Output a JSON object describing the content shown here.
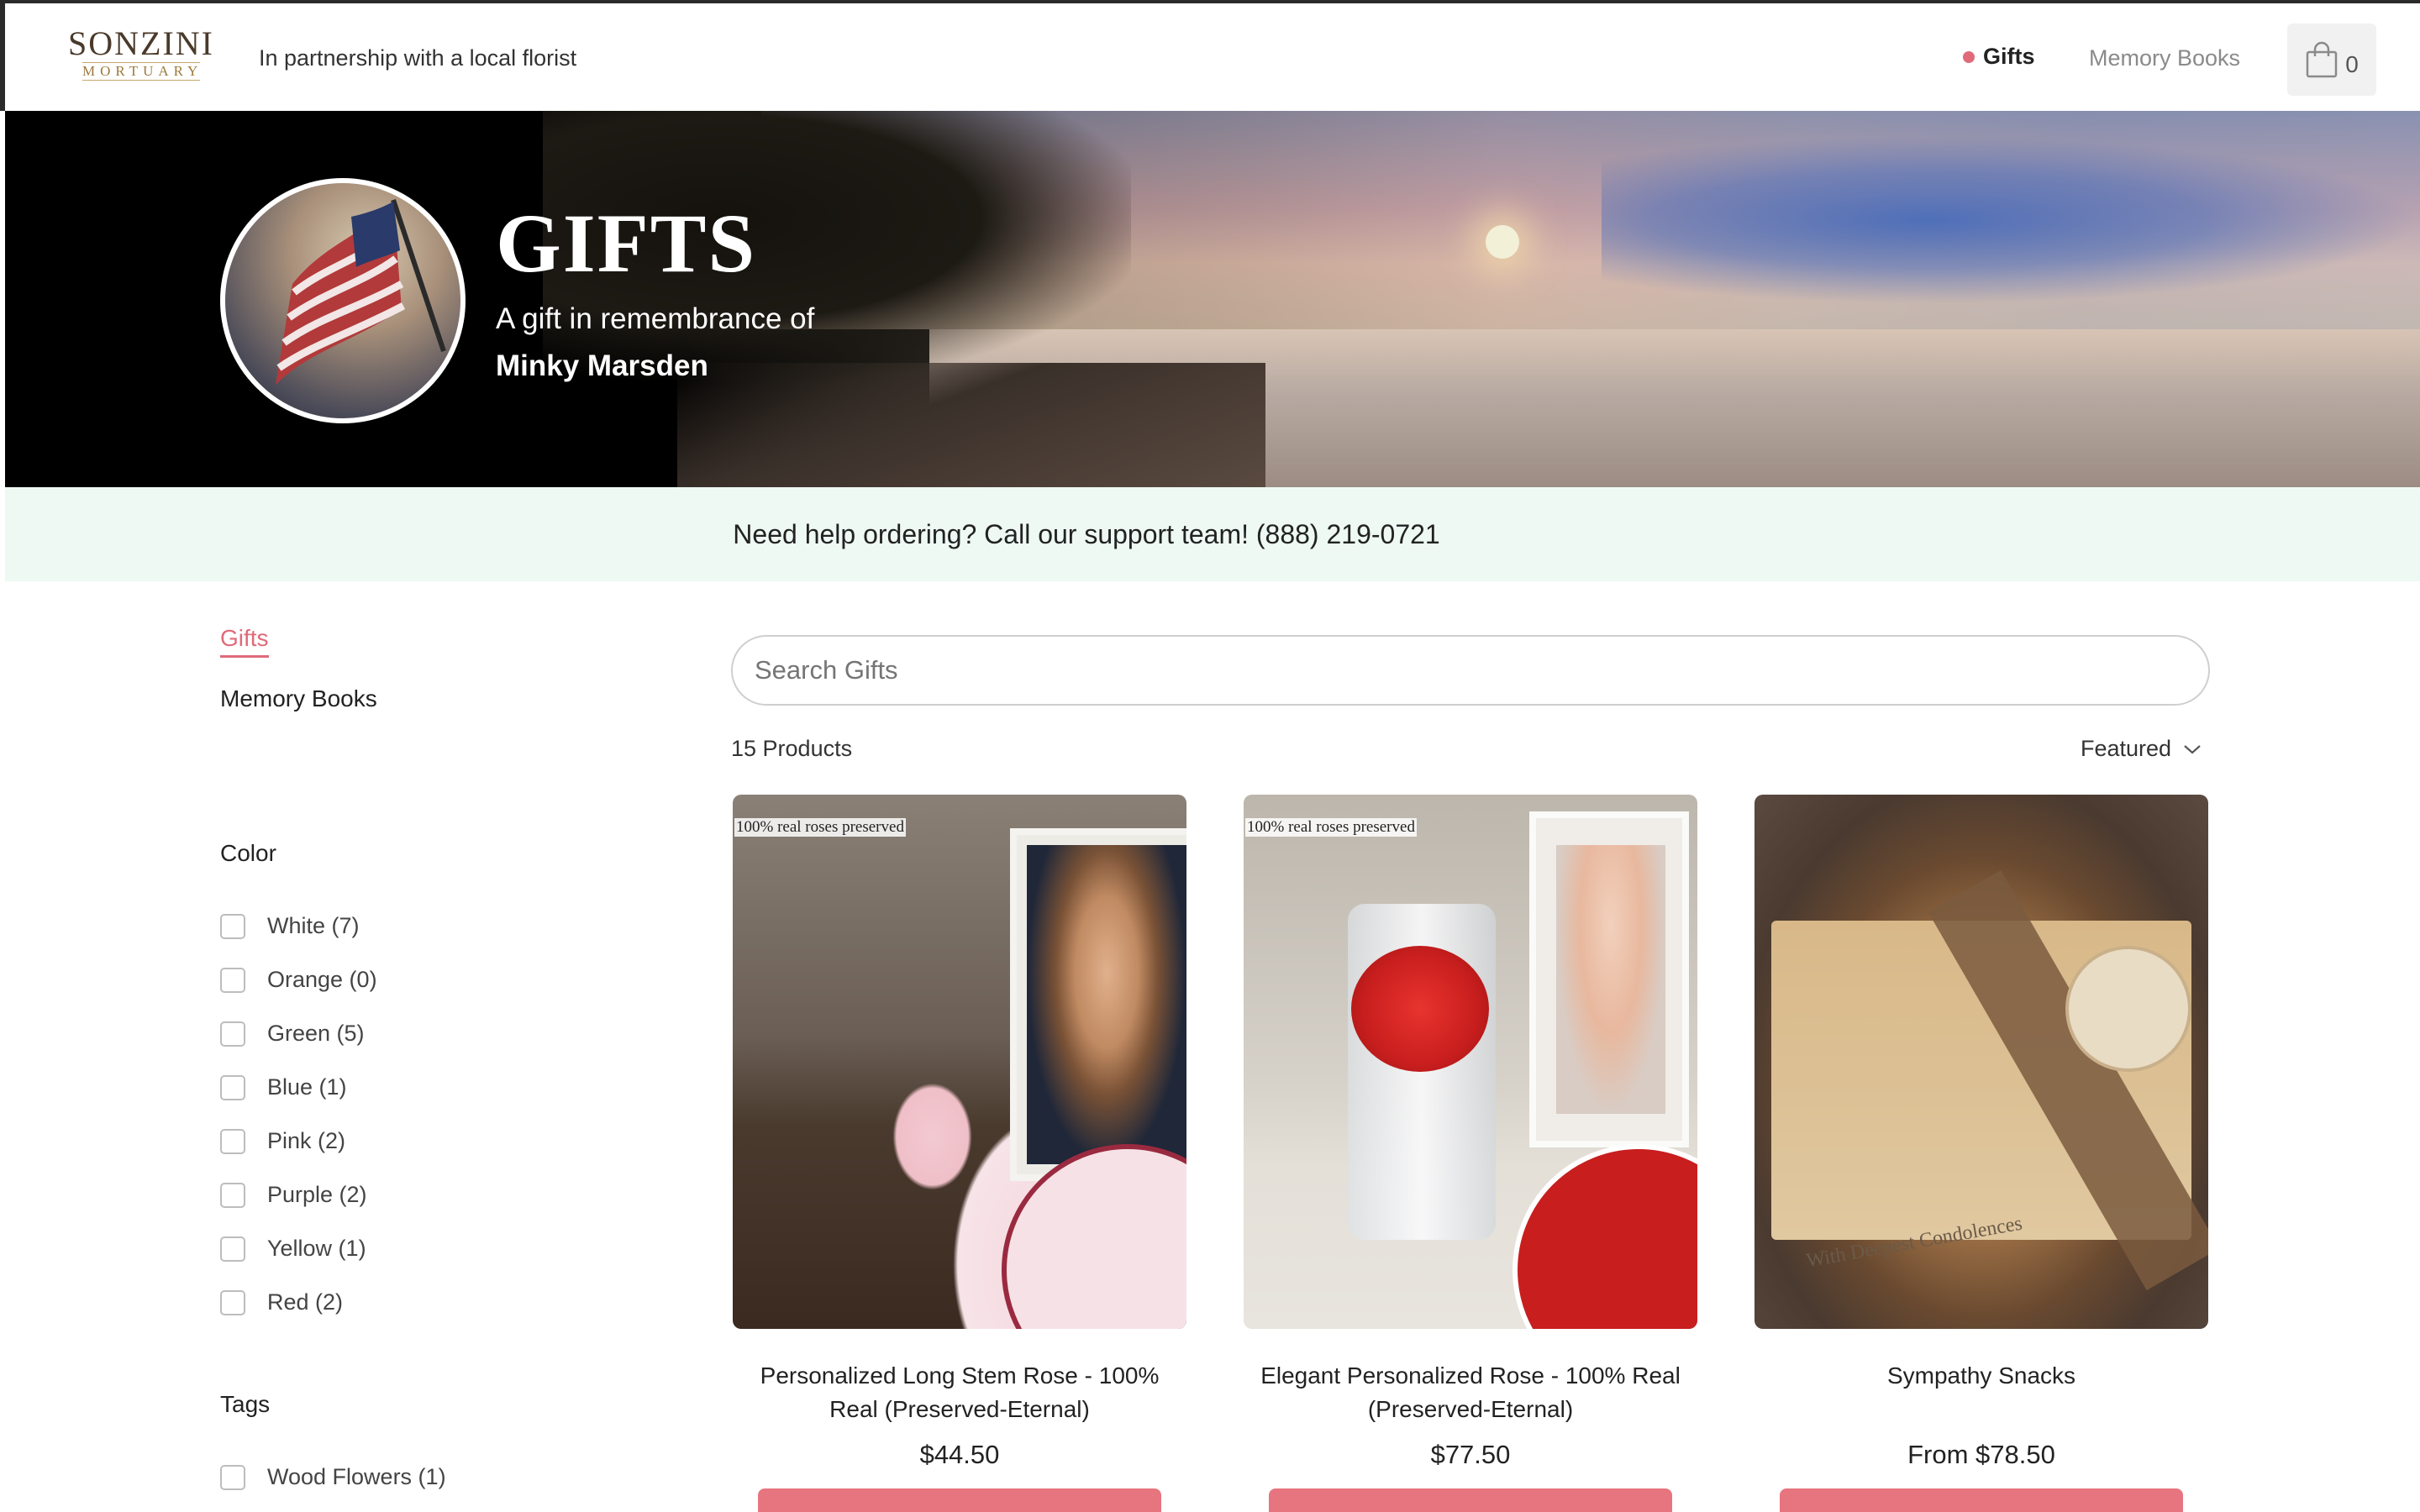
{
  "header": {
    "logo_brand": "SONZINI",
    "logo_sub": "MORTUARY",
    "partner_text": "In partnership with a local florist",
    "nav_gifts": "Gifts",
    "nav_memory": "Memory Books",
    "cart_count": "0",
    "accent_color": "#e06a7a"
  },
  "hero": {
    "title": "GIFTS",
    "subtitle": "A gift in remembrance of",
    "name": "Minky Marsden"
  },
  "help": {
    "text": "Need help ordering? Call our support team! (888) 219-0721"
  },
  "sidebar": {
    "links": [
      {
        "label": "Gifts",
        "active": true
      },
      {
        "label": "Memory Books",
        "active": false
      }
    ],
    "color_heading": "Color",
    "colors": [
      {
        "label": "White (7)"
      },
      {
        "label": "Orange (0)"
      },
      {
        "label": "Green (5)"
      },
      {
        "label": "Blue (1)"
      },
      {
        "label": "Pink (2)"
      },
      {
        "label": "Purple (2)"
      },
      {
        "label": "Yellow (1)"
      },
      {
        "label": "Red (2)"
      }
    ],
    "tags_heading": "Tags",
    "tags": [
      {
        "label": "Wood Flowers (1)"
      }
    ]
  },
  "main": {
    "search_placeholder": "Search Gifts",
    "product_count": "15 Products",
    "sort_label": "Featured",
    "products": [
      {
        "badge": "100% real roses preserved",
        "title": "Personalized Long Stem Rose - 100% Real (Preserved-Eternal)",
        "price": "$44.50"
      },
      {
        "badge": "100% real roses preserved",
        "title": "Elegant Personalized Rose - 100% Real (Preserved-Eternal)",
        "price": "$77.50"
      },
      {
        "title": "Sympathy Snacks",
        "price": "From $78.50",
        "box_label": "With Deepest Condolences"
      }
    ],
    "button_color": "#e7757f"
  }
}
